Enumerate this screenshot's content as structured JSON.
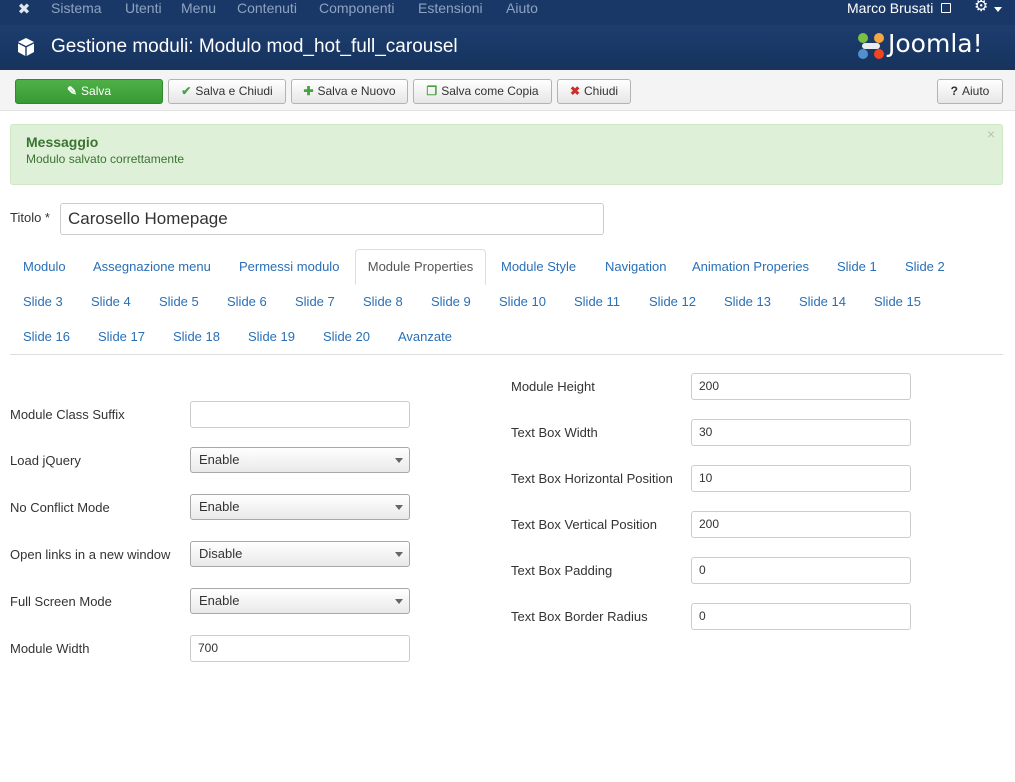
{
  "topbar": {
    "menu": [
      "Sistema",
      "Utenti",
      "Menu",
      "Contenuti",
      "Componenti",
      "Estensioni",
      "Aiuto"
    ],
    "user": "Marco Brusati"
  },
  "header": {
    "title": "Gestione moduli: Modulo mod_hot_full_carousel",
    "brand": "Joomla!"
  },
  "toolbar": {
    "save": "Salva",
    "save_close": "Salva e Chiudi",
    "save_new": "Salva e Nuovo",
    "save_copy": "Salva come Copia",
    "close": "Chiudi",
    "help": "Aiuto"
  },
  "message": {
    "heading": "Messaggio",
    "text": "Modulo salvato correttamente",
    "close": "×"
  },
  "title_field": {
    "label": "Titolo *",
    "value": "Carosello Homepage"
  },
  "tabs": [
    "Modulo",
    "Assegnazione menu",
    "Permessi modulo",
    "Module Properties",
    "Module Style",
    "Navigation",
    "Animation Properies",
    "Slide 1",
    "Slide 2",
    "Slide 3",
    "Slide 4",
    "Slide 5",
    "Slide 6",
    "Slide 7",
    "Slide 8",
    "Slide 9",
    "Slide 10",
    "Slide 11",
    "Slide 12",
    "Slide 13",
    "Slide 14",
    "Slide 15",
    "Slide 16",
    "Slide 17",
    "Slide 18",
    "Slide 19",
    "Slide 20",
    "Avanzate"
  ],
  "active_tab": "Module Properties",
  "left_form": {
    "class_suffix_label": "Module Class Suffix",
    "class_suffix_value": "",
    "load_jquery_label": "Load jQuery",
    "load_jquery_value": "Enable",
    "no_conflict_label": "No Conflict Mode",
    "no_conflict_value": "Enable",
    "new_window_label": "Open links in a new window",
    "new_window_value": "Disable",
    "full_screen_label": "Full Screen Mode",
    "full_screen_value": "Enable",
    "width_label": "Module Width",
    "width_value": "700"
  },
  "right_form": {
    "height_label": "Module Height",
    "height_value": "200",
    "tb_width_label": "Text Box Width",
    "tb_width_value": "30",
    "tb_hpos_label": "Text Box Horizontal Position",
    "tb_hpos_value": "10",
    "tb_vpos_label": "Text Box Vertical Position",
    "tb_vpos_value": "200",
    "tb_padding_label": "Text Box Padding",
    "tb_padding_value": "0",
    "tb_radius_label": "Text Box Border Radius",
    "tb_radius_value": "0"
  },
  "colors": {
    "navbar": "#1a3867",
    "header": "#1c3d6f",
    "save_button": "#46a546",
    "alert_bg": "#dff0d8",
    "link": "#2a6fb6"
  }
}
